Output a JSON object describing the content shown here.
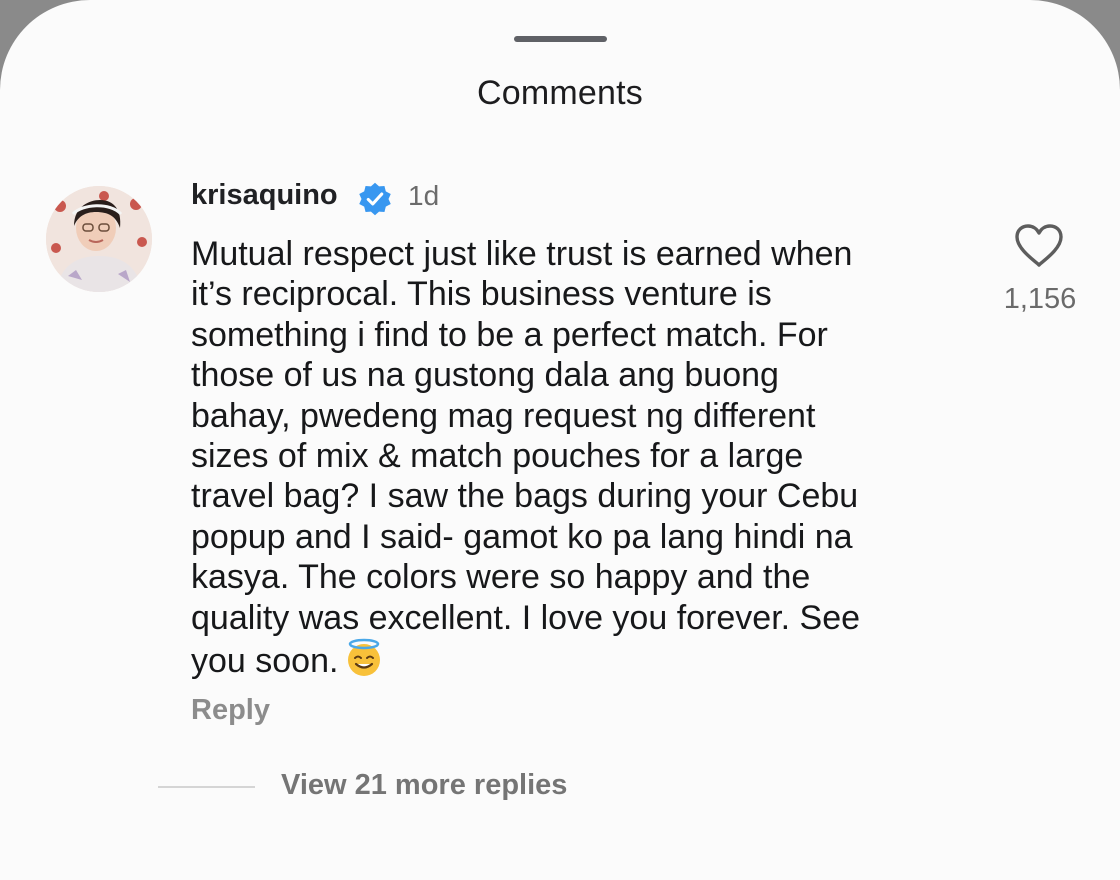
{
  "sheet": {
    "title": "Comments"
  },
  "comment": {
    "username": "krisaquino",
    "verified_icon": "verified-badge-icon",
    "time": "1d",
    "lines": [
      "Mutual respect just like trust is earned when",
      "it’s reciprocal. This business venture is",
      "something i find to be a perfect match. For",
      "those of us na gustong dala ang buong",
      "bahay, pwedeng mag request ng different",
      "sizes of mix & match pouches for a large",
      "travel bag? I saw the bags during your Cebu",
      "popup and I said- gamot ko pa lang hindi na",
      "kasya. The colors were so happy and the",
      "quality was excellent. I love you forever. See",
      "you soon."
    ],
    "emoji": "smiling-face-with-halo",
    "like_icon": "heart-outline-icon",
    "like_count": "1,156",
    "reply_label": "Reply",
    "view_replies_label": "View 21 more replies"
  },
  "colors": {
    "verified_blue": "#3897f0",
    "background": "#fbfbfb"
  }
}
